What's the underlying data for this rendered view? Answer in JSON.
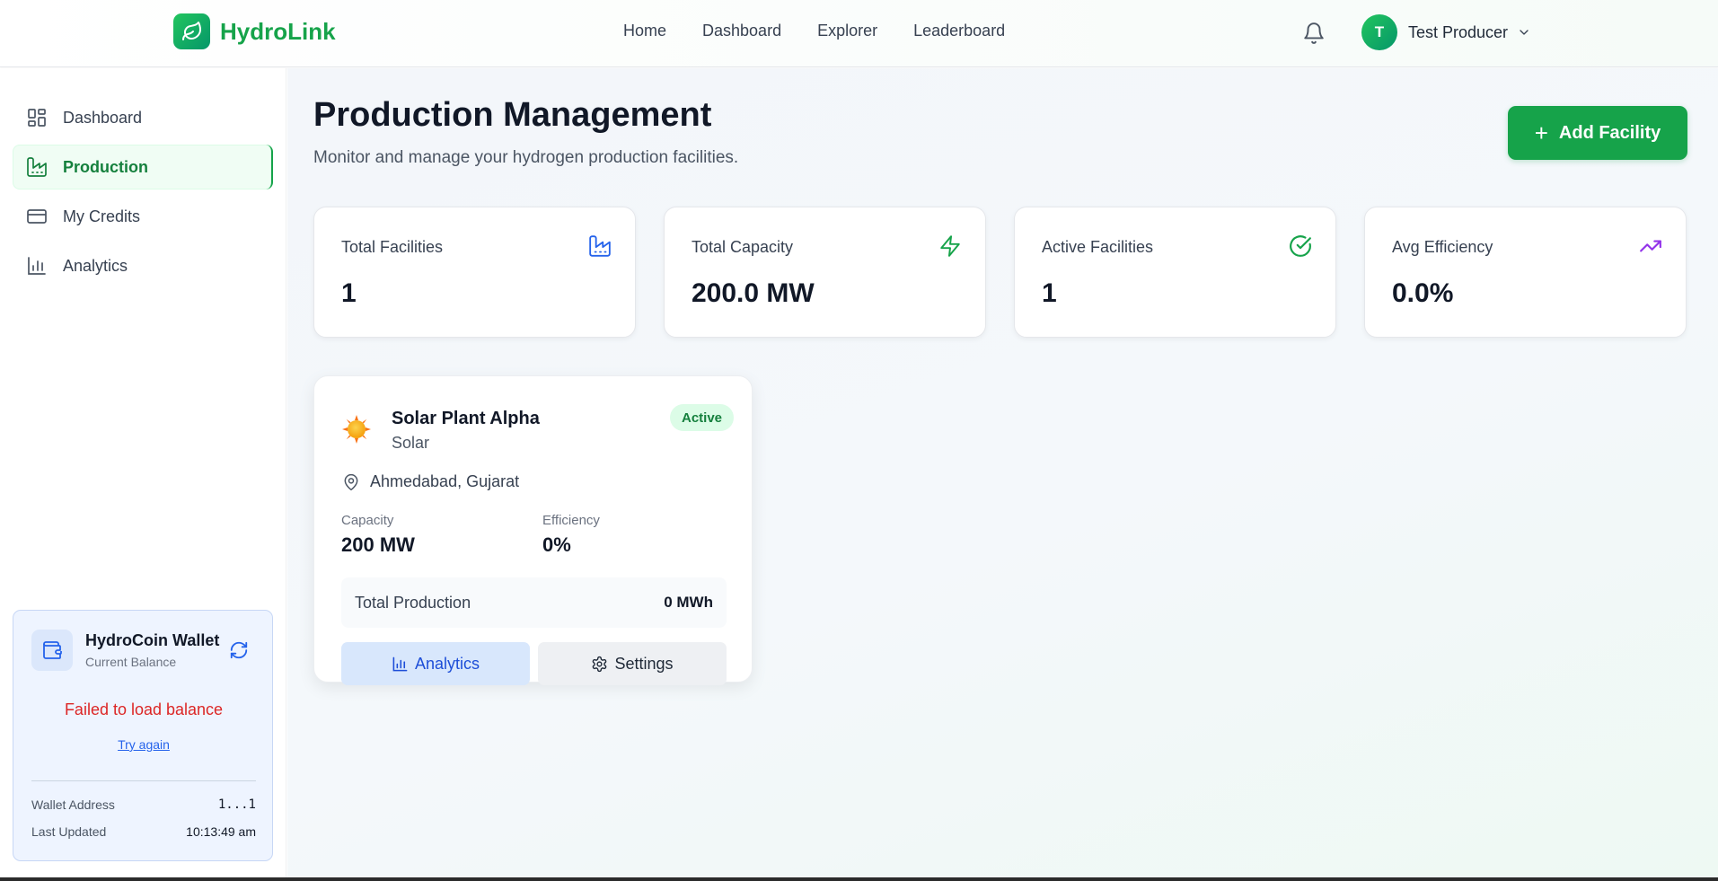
{
  "brand": {
    "name": "HydroLink",
    "color": "#16a34a"
  },
  "topnav": [
    "Home",
    "Dashboard",
    "Explorer",
    "Leaderboard"
  ],
  "user": {
    "initial": "T",
    "name": "Test Producer"
  },
  "sidebar": {
    "items": [
      {
        "label": "Dashboard",
        "icon": "dashboard-grid-icon"
      },
      {
        "label": "Production",
        "icon": "factory-icon",
        "active": true
      },
      {
        "label": "My Credits",
        "icon": "credit-card-icon"
      },
      {
        "label": "Analytics",
        "icon": "bar-chart-icon"
      }
    ]
  },
  "wallet": {
    "title": "HydroCoin Wallet",
    "subtitle": "Current Balance",
    "error": "Failed to load balance",
    "retry": "Try again",
    "address_label": "Wallet Address",
    "address_value": "1...1",
    "updated_label": "Last Updated",
    "updated_value": "10:13:49 am"
  },
  "page": {
    "title": "Production Management",
    "subtitle": "Monitor and manage your hydrogen production facilities.",
    "add_button": "Add Facility"
  },
  "stats": [
    {
      "label": "Total Facilities",
      "value": "1",
      "icon": "factory-icon",
      "color": "#2563eb"
    },
    {
      "label": "Total Capacity",
      "value": "200.0 MW",
      "icon": "lightning-icon",
      "color": "#16a34a"
    },
    {
      "label": "Active Facilities",
      "value": "1",
      "icon": "check-circle-icon",
      "color": "#16a34a"
    },
    {
      "label": "Avg Efficiency",
      "value": "0.0%",
      "icon": "trending-up-icon",
      "color": "#9333ea"
    }
  ],
  "facility": {
    "name": "Solar Plant Alpha",
    "type": "Solar",
    "status": "Active",
    "location": "Ahmedabad, Gujarat",
    "capacity_label": "Capacity",
    "capacity_value": "200 MW",
    "efficiency_label": "Efficiency",
    "efficiency_value": "0%",
    "production_label": "Total Production",
    "production_value": "0 MWh",
    "analytics_button": "Analytics",
    "settings_button": "Settings"
  }
}
